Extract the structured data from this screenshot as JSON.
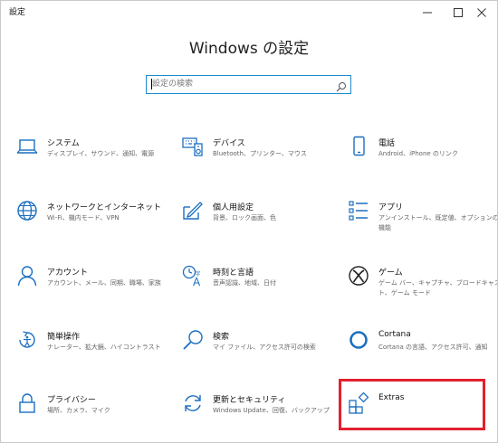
{
  "window": {
    "title": "設定",
    "controls": {
      "minimize": "minimize",
      "maximize": "maximize",
      "close": "close"
    }
  },
  "page": {
    "heading": "Windows の設定",
    "search": {
      "placeholder": "設定の検索",
      "value": ""
    }
  },
  "tiles": {
    "system": {
      "name": "システム",
      "desc": "ディスプレイ、サウンド、通知、電源",
      "icon": "laptop-icon"
    },
    "devices": {
      "name": "デバイス",
      "desc": "Bluetooth、プリンター、マウス",
      "icon": "keyboard-speaker-icon"
    },
    "phone": {
      "name": "電話",
      "desc": "Android、iPhone のリンク",
      "icon": "phone-icon"
    },
    "network": {
      "name": "ネットワークとインターネット",
      "desc": "Wi-Fi、機内モード、VPN",
      "icon": "globe-icon"
    },
    "personalize": {
      "name": "個人用設定",
      "desc": "背景、ロック画面、色",
      "icon": "paint-pen-icon"
    },
    "apps": {
      "name": "アプリ",
      "desc": "アンインストール、既定値、オプションの機能",
      "icon": "app-list-icon"
    },
    "accounts": {
      "name": "アカウント",
      "desc": "アカウント、メール、同期、職場、家族",
      "icon": "person-icon"
    },
    "time-language": {
      "name": "時刻と言語",
      "desc": "音声認識、地域、日付",
      "icon": "time-language-icon"
    },
    "gaming": {
      "name": "ゲーム",
      "desc": "ゲーム バー、キャプチャ、ブロードキャスト、ゲーム モード",
      "icon": "xbox-icon"
    },
    "ease-access": {
      "name": "簡単操作",
      "desc": "ナレーター、拡大鏡、ハイコントラスト",
      "icon": "ease-of-access-icon"
    },
    "search": {
      "name": "検索",
      "desc": "マイ ファイル、アクセス許可の検索",
      "icon": "search-icon"
    },
    "cortana": {
      "name": "Cortana",
      "desc": "Cortana の言語、アクセス許可、通知",
      "icon": "cortana-icon"
    },
    "privacy": {
      "name": "プライバシー",
      "desc": "場所、カメラ、マイク",
      "icon": "lock-icon"
    },
    "update": {
      "name": "更新とセキュリティ",
      "desc": "Windows Update、回復、バックアップ",
      "icon": "sync-icon"
    },
    "extras": {
      "name": "Extras",
      "desc": "",
      "icon": "extras-icon"
    }
  },
  "colors": {
    "accent": "#1b6fc1",
    "search_border": "#1b8ad1",
    "highlight": "#e2202f"
  }
}
